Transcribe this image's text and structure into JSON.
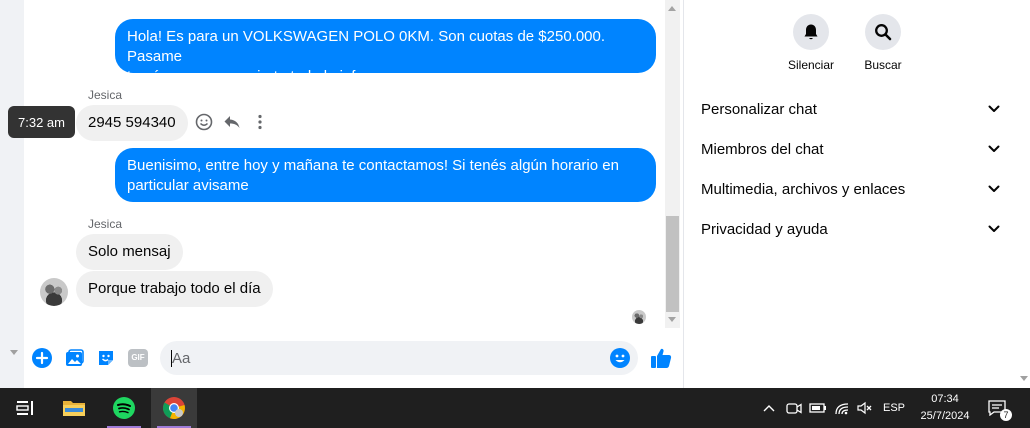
{
  "messages": {
    "out1": {
      "line1": "Hola! Es para un VOLKSWAGEN POLO 0KM.  Son cuotas de $250.000. Pasame",
      "line2": "tu número para enviarte toda la info"
    },
    "in1": {
      "sender": "Jesica",
      "text": "2945 594340"
    },
    "out2": {
      "line1": "Buenisimo, entre hoy y mañana te contactamos! Si tenés algún horario en",
      "line2": "particular avisame"
    },
    "in2": {
      "sender": "Jesica",
      "text1": "Solo mensaj",
      "text2": "Porque trabajo todo el día"
    }
  },
  "tooltip": {
    "time": "7:32 am"
  },
  "composer": {
    "placeholder": "Aa",
    "gif_label": "GIF"
  },
  "right_panel": {
    "actions": [
      {
        "label": "Silenciar",
        "icon": "bell-icon"
      },
      {
        "label": "Buscar",
        "icon": "search-icon"
      }
    ],
    "sections": [
      {
        "label": "Personalizar chat"
      },
      {
        "label": "Miembros del chat"
      },
      {
        "label": "Multimedia, archivos y enlaces"
      },
      {
        "label": "Privacidad y ayuda"
      }
    ]
  },
  "taskbar": {
    "apps": [
      {
        "name": "task-view",
        "icon": "task-view-icon"
      },
      {
        "name": "file-explorer",
        "icon": "folder-icon"
      },
      {
        "name": "spotify",
        "icon": "spotify-icon"
      },
      {
        "name": "chrome",
        "icon": "chrome-icon"
      }
    ],
    "language": "ESP",
    "time": "07:34",
    "date": "25/7/2024",
    "notification_count": "7"
  },
  "colors": {
    "accent": "#0084ff",
    "incoming_bubble": "#f0f0f0",
    "taskbar": "#1f1f1f",
    "spotify": "#1ed760"
  }
}
